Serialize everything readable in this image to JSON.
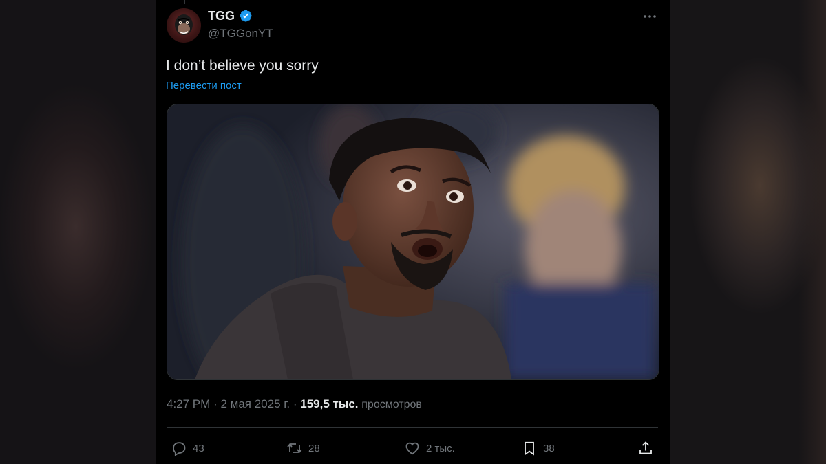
{
  "author": {
    "display_name": "TGG",
    "handle": "@TGGonYT",
    "verified": true,
    "avatar_icon": "gorilla-avatar-icon"
  },
  "post": {
    "text": "I don’t believe you sorry",
    "translate_label": "Перевести пост"
  },
  "media": {
    "alt": ""
  },
  "meta": {
    "time": "4:27 PM",
    "separator": "·",
    "date": "2 мая 2025 г.",
    "views_count": "159,5 тыс.",
    "views_label": "просмотров"
  },
  "actions": {
    "replies": "43",
    "reposts": "28",
    "likes": "2 тыс.",
    "bookmarks": "38"
  },
  "colors": {
    "accent": "#1d9bf0",
    "background": "#000000",
    "text_primary": "#e7e9ea",
    "text_secondary": "#71767b",
    "border": "#2f3336"
  }
}
